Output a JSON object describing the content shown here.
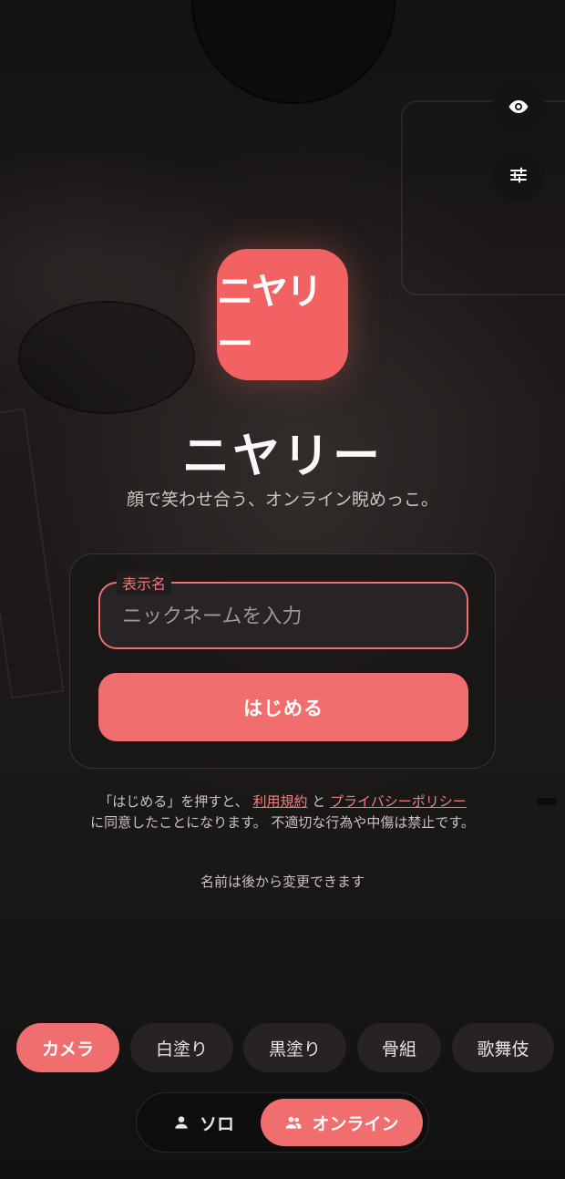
{
  "app": {
    "logo_text": "ニヤリー",
    "title": "ニヤリー",
    "tagline": "顔で笑わせ合う、オンライン睨めっこ。"
  },
  "top_buttons": [
    {
      "icon": "eye-icon"
    },
    {
      "icon": "sliders-icon"
    }
  ],
  "form": {
    "field_label": "表示名",
    "placeholder": "ニックネームを入力",
    "value": "",
    "start_label": "はじめる"
  },
  "terms": {
    "prefix": "「はじめる」を押すと、",
    "link_terms": "利用規約",
    "and": "と",
    "link_privacy": "プライバシーポリシー",
    "suffix": "に同意したことになります。 不適切な行為や中傷は禁止です。"
  },
  "note": "名前は後から変更できます",
  "filters": [
    {
      "label": "カメラ",
      "active": true
    },
    {
      "label": "白塗り",
      "active": false
    },
    {
      "label": "黒塗り",
      "active": false
    },
    {
      "label": "骨組",
      "active": false
    },
    {
      "label": "歌舞伎",
      "active": false
    }
  ],
  "mode": {
    "solo_label": "ソロ",
    "online_label": "オンライン",
    "selected": "オンライン"
  },
  "colors": {
    "accent": "#f16e6e",
    "background": "#1b1818"
  }
}
